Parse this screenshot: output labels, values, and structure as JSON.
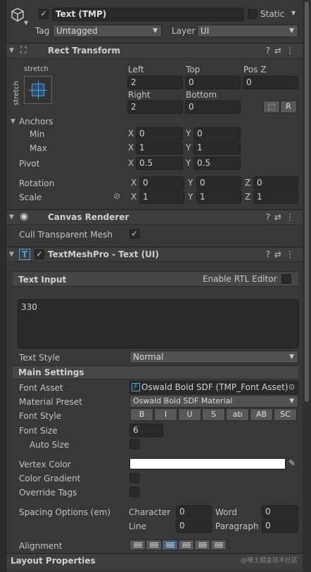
{
  "gameobject": {
    "name": "Text (TMP)",
    "static_label": "Static",
    "tag_label": "Tag",
    "tag_value": "Untagged",
    "layer_label": "Layer",
    "layer_value": "UI"
  },
  "rect_transform": {
    "title": "Rect Transform",
    "preset_top": "stretch",
    "preset_side": "stretch",
    "left_label": "Left",
    "left": "2",
    "top_label": "Top",
    "top": "0",
    "posz_label": "Pos Z",
    "posz": "0",
    "right_label": "Right",
    "right": "2",
    "bottom_label": "Bottom",
    "bottom": "0",
    "r_button": "R",
    "anchors_label": "Anchors",
    "min_label": "Min",
    "min_x": "0",
    "min_y": "0",
    "max_label": "Max",
    "max_x": "1",
    "max_y": "1",
    "pivot_label": "Pivot",
    "pivot_x": "0.5",
    "pivot_y": "0.5",
    "rotation_label": "Rotation",
    "rot_x": "0",
    "rot_y": "0",
    "rot_z": "0",
    "scale_label": "Scale",
    "scale_x": "1",
    "scale_y": "1",
    "scale_z": "1",
    "x": "X",
    "y": "Y",
    "z": "Z"
  },
  "canvas_renderer": {
    "title": "Canvas Renderer",
    "cull_label": "Cull Transparent Mesh",
    "cull_checked": true
  },
  "tmp": {
    "title": "TextMeshPro - Text (UI)",
    "text_input_label": "Text Input",
    "rtl_label": "Enable RTL Editor",
    "text_value": "330",
    "text_style_label": "Text Style",
    "text_style_value": "Normal",
    "main_settings_label": "Main Settings",
    "font_asset_label": "Font Asset",
    "font_asset_value": "Oswald Bold SDF (TMP_Font Asset)",
    "material_preset_label": "Material Preset",
    "material_preset_value": "Oswald Bold SDF Material",
    "font_style_label": "Font Style",
    "font_style_buttons": [
      "B",
      "I",
      "U",
      "S",
      "ab",
      "AB",
      "SC"
    ],
    "font_size_label": "Font Size",
    "font_size_value": "6",
    "auto_size_label": "Auto Size",
    "vertex_color_label": "Vertex Color",
    "vertex_color": "#ffffff",
    "color_gradient_label": "Color Gradient",
    "override_tags_label": "Override Tags",
    "spacing_label": "Spacing Options (em)",
    "character_label": "Character",
    "character_value": "0",
    "word_label": "Word",
    "word_value": "0",
    "line_label": "Line",
    "line_value": "0",
    "paragraph_label": "Paragraph",
    "paragraph_value": "0",
    "alignment_label": "Alignment"
  },
  "layout_properties": {
    "title": "Layout Properties"
  },
  "watermark": "@稀土掘金技术社区",
  "colors": {
    "background": "#383838",
    "field": "#2a2a2a",
    "accent": "#46607f",
    "tmp_icon": "#4aa3e0"
  }
}
